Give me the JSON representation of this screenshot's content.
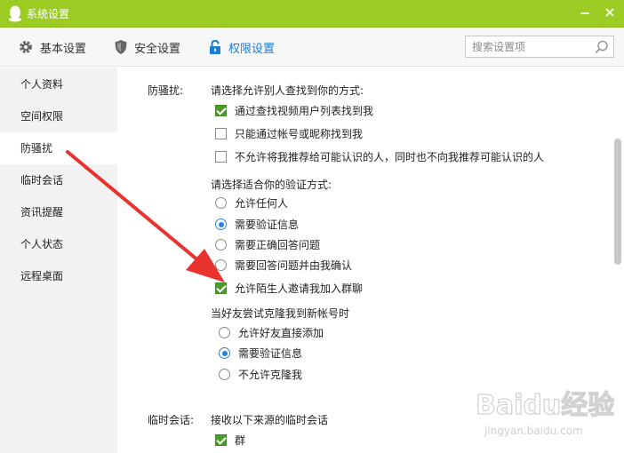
{
  "window": {
    "title": "系统设置"
  },
  "toolbar": {
    "tabs": [
      {
        "label": "基本设置",
        "icon": "gear-icon"
      },
      {
        "label": "安全设置",
        "icon": "shield-icon"
      },
      {
        "label": "权限设置",
        "icon": "lock-icon",
        "active": true
      }
    ],
    "search_placeholder": "搜索设置项"
  },
  "sidebar": {
    "items": [
      {
        "label": "个人资料"
      },
      {
        "label": "空间权限"
      },
      {
        "label": "防骚扰",
        "active": true
      },
      {
        "label": "临时会话"
      },
      {
        "label": "资讯提醒"
      },
      {
        "label": "个人状态"
      },
      {
        "label": "远程桌面"
      }
    ]
  },
  "content": {
    "anti_harass": {
      "label": "防骚扰:",
      "find_heading": "请选择允许别人查找到你的方式:",
      "find_options": [
        {
          "label": "通过查找视频用户列表找到我",
          "checked": true
        },
        {
          "label": "只能通过帐号或昵称找到我",
          "checked": false
        },
        {
          "label": "不允许将我推荐给可能认识的人，同时也不向我推荐可能认识的人",
          "checked": false
        }
      ],
      "verify_heading": "请选择适合你的验证方式:",
      "verify_options": [
        {
          "label": "允许任何人",
          "selected": false
        },
        {
          "label": "需要验证信息",
          "selected": true
        },
        {
          "label": "需要正确回答问题",
          "selected": false
        },
        {
          "label": "需要回答问题并由我确认",
          "selected": false
        }
      ],
      "group_invite": {
        "label": "允许陌生人邀请我加入群聊",
        "checked": true
      },
      "clone_heading": "当好友尝试克隆我到新帐号时",
      "clone_options": [
        {
          "label": "允许好友直接添加",
          "selected": false
        },
        {
          "label": "需要验证信息",
          "selected": true
        },
        {
          "label": "不允许克隆我",
          "selected": false
        }
      ]
    },
    "temp_session": {
      "label": "临时会话:",
      "heading": "接收以下来源的临时会话",
      "options": [
        {
          "label": "群",
          "checked": true
        }
      ]
    }
  },
  "watermark": {
    "brand": "Baidu经验",
    "url": "jingyan.baidu.com"
  },
  "colors": {
    "title_bar": "#9ccc24",
    "accent": "#1e7cd4",
    "checkbox": "#4a9a2c",
    "arrow": "#e8332f"
  }
}
